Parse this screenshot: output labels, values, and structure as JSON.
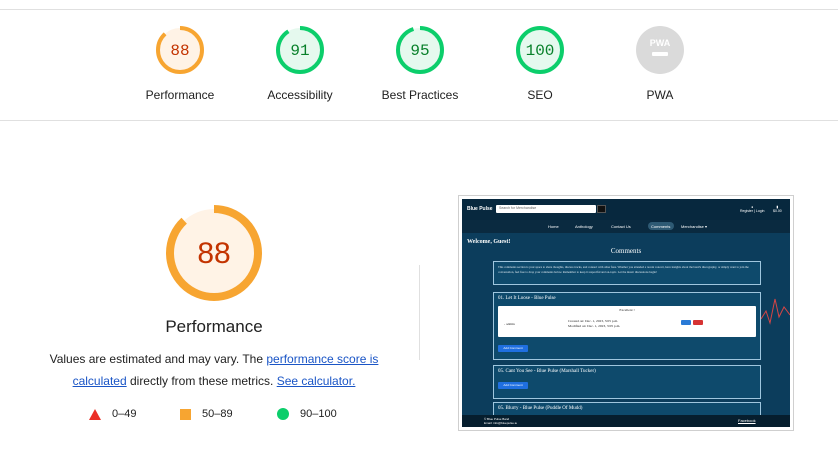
{
  "summary": {
    "gauges": [
      {
        "label": "Performance",
        "score": "88",
        "value": 0.88,
        "color": "#f7a531",
        "fill": "#fff3e6",
        "text_color": "#c33300"
      },
      {
        "label": "Accessibility",
        "score": "91",
        "value": 0.91,
        "color": "#0cce6b",
        "fill": "#e5f9ee",
        "text_color": "#08802a"
      },
      {
        "label": "Best Practices",
        "score": "95",
        "value": 0.95,
        "color": "#0cce6b",
        "fill": "#e5f9ee",
        "text_color": "#08802a"
      },
      {
        "label": "SEO",
        "score": "100",
        "value": 1.0,
        "color": "#0cce6b",
        "fill": "#e5f9ee",
        "text_color": "#08802a"
      },
      {
        "label": "PWA",
        "score": "",
        "value": 0,
        "color": "#dadada",
        "fill": "#dadada",
        "text_color": "#ffffff",
        "icon": "pwa-icon"
      }
    ]
  },
  "performance": {
    "score": "88",
    "value": 0.88,
    "title": "Performance",
    "desc_prefix": "Values are estimated and may vary. The ",
    "desc_link1": "performance score is calculated",
    "desc_middle": " directly from these metrics. ",
    "desc_link2": "See calculator.",
    "colors": {
      "ring": "#f7a531",
      "fill": "#fff3e6",
      "text": "#c33300"
    }
  },
  "legend": [
    {
      "range": "0–49",
      "shape": "triangle",
      "color": "#eb2f26"
    },
    {
      "range": "50–89",
      "shape": "square",
      "color": "#f7a531"
    },
    {
      "range": "90–100",
      "shape": "circle",
      "color": "#0cce6b"
    }
  ],
  "screenshot": {
    "brand": "Blue Pulse",
    "search_placeholder": "Search for Merchandise",
    "account": "Register | Login",
    "bag": "$0.00",
    "nav": [
      "Home",
      "Anthology",
      "Contact Us",
      "Comments",
      "Merchandise ▾"
    ],
    "welcome": "Welcome, Guest!",
    "heading": "Comments",
    "intro": "This comments section is your space to share thoughts, discuss tracks, and connect with other fans. Whether you attended a recent concert, have insights about the band's discography, or simply want to join the conversation, feel free to drop your comments below. Remember to keep it respectful and on-topic. Let the music discussions begin!",
    "comments": [
      {
        "title": "01. Let It Loose - Blue Pulse",
        "body": "Excellent !",
        "author": "- admin",
        "created": "Created on: Dec. 1, 2023, 3:05 p.m.",
        "modified": "Modified on: Dec. 1, 2023, 3:05 p.m.",
        "add": "Add Comment"
      },
      {
        "title": "05. Cant You See - Blue Pulse (Marshall Tucker)",
        "add": "Add Comment"
      },
      {
        "title": "05. Blurry - Blue Pulse (Puddle Of Mudd)"
      }
    ],
    "footer_left": "© Blue Pulse Band\nEmail: info@bluepulse.ie",
    "footer_right": "Facebook"
  }
}
